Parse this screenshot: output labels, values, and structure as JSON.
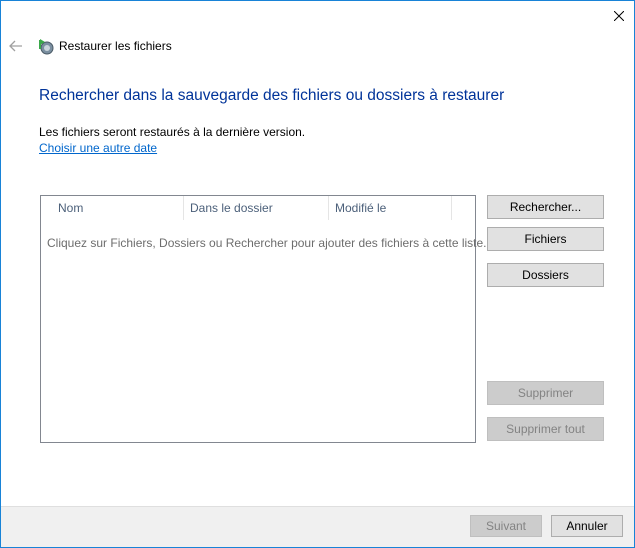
{
  "window": {
    "title": "Restaurer les fichiers",
    "back_icon": "back-arrow-icon",
    "app_icon": "restore-files-icon",
    "close_icon": "close-icon"
  },
  "main": {
    "heading": "Rechercher dans la sauvegarde des fichiers ou dossiers à restaurer",
    "info": "Les fichiers seront restaurés à la dernière version.",
    "change_date_link": "Choisir une autre date"
  },
  "file_list": {
    "columns": [
      "Nom",
      "Dans le dossier",
      "Modifié le"
    ],
    "empty_message": "Cliquez sur Fichiers, Dossiers ou Rechercher pour ajouter des fichiers à cette liste."
  },
  "buttons": {
    "search": "Rechercher...",
    "files": "Fichiers",
    "folders": "Dossiers",
    "remove": "Supprimer",
    "remove_all": "Supprimer tout"
  },
  "footer": {
    "next": "Suivant",
    "cancel": "Annuler"
  },
  "colors": {
    "heading": "#003399",
    "link": "#0066cc",
    "window_border": "#1883d7"
  }
}
